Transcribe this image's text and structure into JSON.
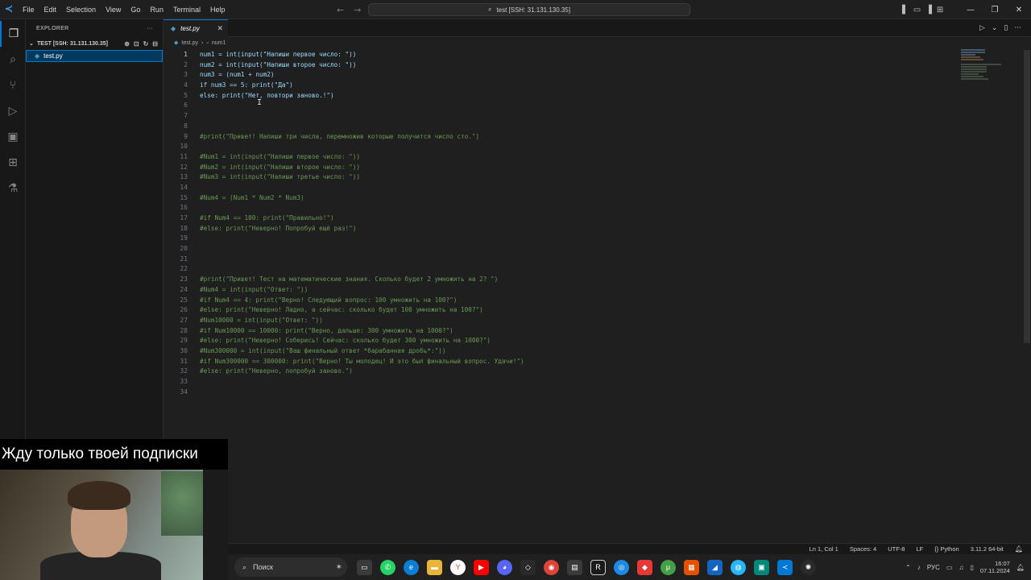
{
  "titlebar": {
    "menu": [
      "File",
      "Edit",
      "Selection",
      "View",
      "Go",
      "Run",
      "Terminal",
      "Help"
    ],
    "command_center": "test [SSH: 31.131.130.35]"
  },
  "sidebar": {
    "title": "EXPLORER",
    "folder": "TEST [SSH: 31.131.130.35]",
    "file": "test.py"
  },
  "editor": {
    "tab": "test.py",
    "breadcrumb_file": "test.py",
    "breadcrumb_symbol": "num1",
    "line_numbers": [
      "1",
      "2",
      "3",
      "4",
      "5",
      "6",
      "7",
      "8",
      "9",
      "10",
      "11",
      "12",
      "13",
      "14",
      "15",
      "16",
      "17",
      "18",
      "19",
      "20",
      "21",
      "22",
      "23",
      "24",
      "25",
      "26",
      "27",
      "28",
      "29",
      "30",
      "31",
      "32",
      "33",
      "34"
    ],
    "lines": [
      "num1 = int(input(\"Напиши первое число: \"))",
      "num2 = int(input(\"Напиши второе число: \"))",
      "num3 = (num1 + num2)",
      "if num3 == 5: print(\"Да\")",
      "else: print(\"Нет, повтори заново.!\")",
      "",
      "",
      "",
      "#print(\"Привет! Напиши три числа, перемножив которые получится число сто.\")",
      "",
      "#Num1 = int(input(\"Напиши первое число: \"))",
      "#Num2 = int(input(\"Напиши второе число: \"))",
      "#Num3 = int(input(\"Напиши третье число: \"))",
      "",
      "#Num4 = (Num1 * Num2 * Num3)",
      "",
      "#if Num4 == 100: print(\"Правильно!\")",
      "#else: print(\"Неверно! Попробуй ещё раз!\")",
      "",
      "",
      "",
      "",
      "#print(\"Привет! Тест на математические знания. Сколько будет 2 умножить на 2? \")",
      "#Num4 = int(input(\"Ответ: \"))",
      "#if Num4 == 4: print(\"Верно! Следующий вопрос: 100 умножить на 100?\")",
      "#else: print(\"Неверно! Ладно, а сейчас: сколько будет 100 умножить на 100?\")",
      "#Num10000 = int(input(\"Ответ: \"))",
      "#if Num10000 == 10000: print(\"Верно, дальше: 300 умножить на 1000?\")",
      "#else: print(\"Неверно! Соберись! Сейчас: сколько будет 300 умножить на 1000?\")",
      "#Num300000 = int(input(\"Ваш финальный ответ *барабанная дробь*:\"))",
      "#if Num300000 == 300000: print(\"Верно! Ты молодец! И это был финальный вопрос. Удачи!\")",
      "#else: print(\"Неверно, попробуй заново.\")",
      "",
      ""
    ]
  },
  "webcam": {
    "caption": "Жду только твоей подписки"
  },
  "statusbar": {
    "position": "Ln 1, Col 1",
    "spaces": "Spaces: 4",
    "encoding": "UTF-8",
    "eol": "LF",
    "language": "Python",
    "interpreter": "3.11.2 64-bit"
  },
  "taskbar": {
    "search": "Поиск",
    "lang": "РУС",
    "time": "16:07",
    "date": "07.11.2024"
  }
}
